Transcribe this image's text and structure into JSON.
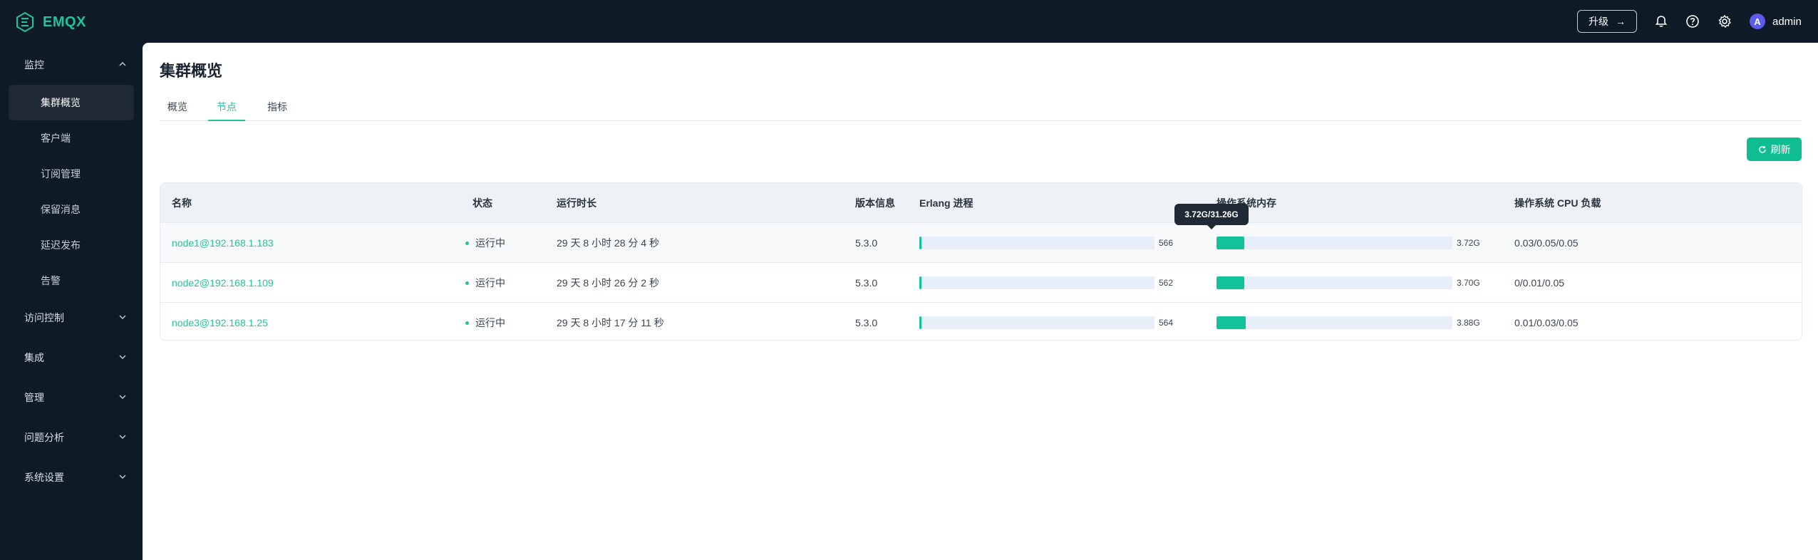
{
  "app": {
    "logo_text": "EMQX"
  },
  "header": {
    "upgrade_label": "升级",
    "user_avatar_letter": "A",
    "username": "admin"
  },
  "sidebar": {
    "groups": [
      {
        "label": "监控",
        "expanded": true
      },
      {
        "label": "访问控制"
      },
      {
        "label": "集成"
      },
      {
        "label": "管理"
      },
      {
        "label": "问题分析"
      },
      {
        "label": "系统设置"
      }
    ],
    "monitor_items": [
      {
        "label": "集群概览",
        "active": true
      },
      {
        "label": "客户端"
      },
      {
        "label": "订阅管理"
      },
      {
        "label": "保留消息"
      },
      {
        "label": "延迟发布"
      },
      {
        "label": "告警"
      }
    ]
  },
  "page": {
    "title": "集群概览",
    "tabs": [
      {
        "label": "概览"
      },
      {
        "label": "节点",
        "active": true
      },
      {
        "label": "指标"
      }
    ],
    "refresh_label": "刷新"
  },
  "table": {
    "columns": [
      "名称",
      "状态",
      "运行时长",
      "版本信息",
      "Erlang 进程",
      "操作系统内存",
      "操作系统 CPU 负载"
    ],
    "rows": [
      {
        "name": "node1@192.168.1.183",
        "status": "运行中",
        "uptime": "29 天 8 小时 28 分 4 秒",
        "version": "5.3.0",
        "erlang": "566",
        "erlang_fraction": 0.01,
        "memory": "3.72G",
        "memory_fraction": 0.119,
        "cpu": "0.03/0.05/0.05"
      },
      {
        "name": "node2@192.168.1.109",
        "status": "运行中",
        "uptime": "29 天 8 小时 26 分 2 秒",
        "version": "5.3.0",
        "erlang": "562",
        "erlang_fraction": 0.01,
        "memory": "3.70G",
        "memory_fraction": 0.118,
        "cpu": "0/0.01/0.05"
      },
      {
        "name": "node3@192.168.1.25",
        "status": "运行中",
        "uptime": "29 天 8 小时 17 分 11 秒",
        "version": "5.3.0",
        "erlang": "564",
        "erlang_fraction": 0.01,
        "memory": "3.88G",
        "memory_fraction": 0.124,
        "cpu": "0.01/0.03/0.05"
      }
    ]
  },
  "tooltip": {
    "text": "3.72G/31.26G"
  },
  "colors": {
    "accent": "#1ec49b",
    "sidebar_bg": "#0e1a26",
    "bar_fill": "#12c29b"
  }
}
